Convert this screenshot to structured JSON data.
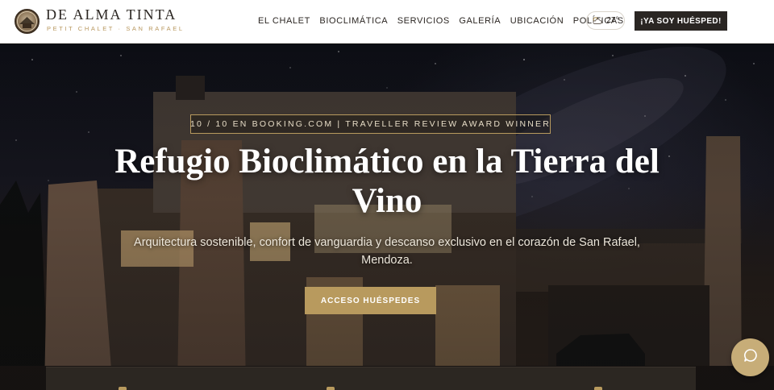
{
  "brand": {
    "name": "DE ALMA TINTA",
    "subtitle": "PETIT CHALET · SAN RAFAEL",
    "logo_icon": "chalet-logo-icon"
  },
  "nav": {
    "items": [
      {
        "label": "EL CHALET"
      },
      {
        "label": "BIOCLIMÁTICA"
      },
      {
        "label": "SERVICIOS"
      },
      {
        "label": "GALERÍA"
      },
      {
        "label": "UBICACIÓN"
      },
      {
        "label": "POLÍTICAS"
      }
    ]
  },
  "weather": {
    "icon": "cloud-sun-icon",
    "temperature": "27°"
  },
  "guest_button": {
    "label": "¡YA SOY HUÉSPED!"
  },
  "hero": {
    "award": "10 / 10 EN BOOKING.COM | TRAVELLER REVIEW AWARD WINNER",
    "title": "Refugio Bioclimático en la Tierra del Vino",
    "subtitle": "Arquitectura sostenible, confort de vanguardia y descanso exclusivo en el corazón de San Rafael, Mendoza.",
    "cta_label": "ACCESO HUÉSPEDES"
  },
  "chat": {
    "icon": "chat-bubble-icon"
  },
  "colors": {
    "accent_gold": "#b89a5e",
    "dark_button": "#2a2623",
    "header_bg": "#ffffff",
    "chat_button": "#c7ad78"
  }
}
